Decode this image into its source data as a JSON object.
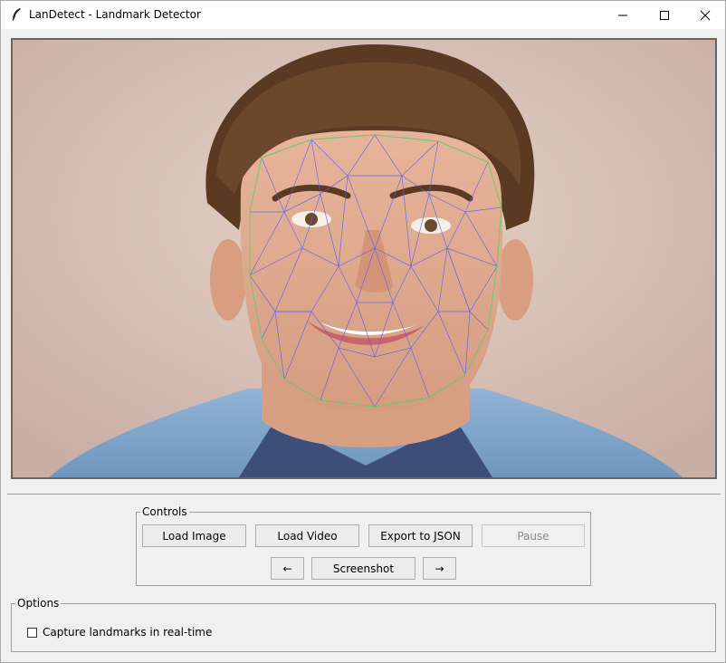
{
  "window": {
    "title": "LanDetect - Landmark Detector",
    "minimize_glyph": "—",
    "maximize_glyph": "☐",
    "close_glyph": "✕"
  },
  "controls": {
    "legend": "Controls",
    "load_image": "Load Image",
    "load_video": "Load Video",
    "export_json": "Export to JSON",
    "pause": "Pause",
    "prev": "←",
    "screenshot": "Screenshot",
    "next": "→"
  },
  "options": {
    "legend": "Options",
    "realtime_label": "Capture landmarks in real-time",
    "realtime_checked": false
  },
  "colors": {
    "mesh": "#5a5aff",
    "face_outline": "#6ad06a",
    "background": "#f0f0f0"
  }
}
